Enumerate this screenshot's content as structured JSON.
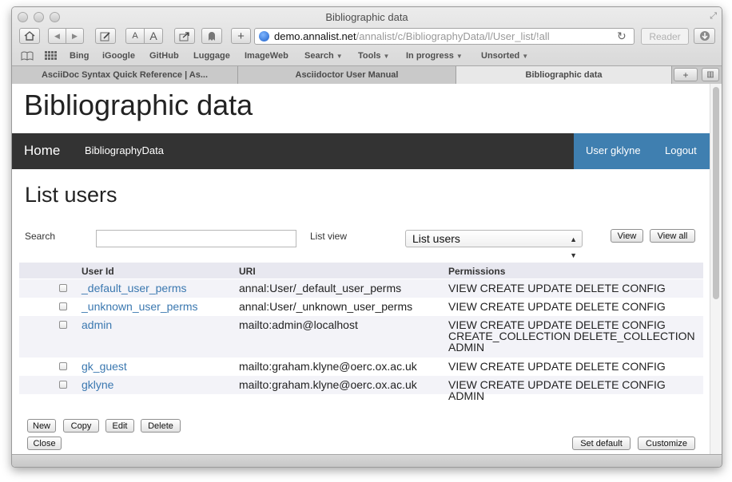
{
  "window": {
    "title": "Bibliographic data"
  },
  "toolbar": {
    "font_small": "A",
    "font_large": "A",
    "new_tab": "+",
    "reader": "Reader"
  },
  "address": {
    "host": "demo.annalist.net",
    "path": "/annalist/c/BibliographyData/l/User_list/!all"
  },
  "bookmarks": [
    {
      "label": "Bing"
    },
    {
      "label": "iGoogle"
    },
    {
      "label": "GitHub"
    },
    {
      "label": "Luggage"
    },
    {
      "label": "ImageWeb"
    },
    {
      "label": "Search",
      "arrow": "▼"
    },
    {
      "label": "Tools",
      "arrow": "▼"
    },
    {
      "label": "In progress",
      "arrow": "▼"
    },
    {
      "label": "Unsorted",
      "arrow": "▼"
    }
  ],
  "tabs": [
    {
      "label": "AsciiDoc Syntax Quick Reference | As..."
    },
    {
      "label": "Asciidoctor User Manual"
    },
    {
      "label": "Bibliographic data"
    }
  ],
  "tabbar": {
    "new_tab": "+",
    "list": "▥"
  },
  "site": {
    "title": "Bibliographic data"
  },
  "nav": {
    "home": "Home",
    "collection": "BibliographyData",
    "user": "User gklyne",
    "logout": "Logout"
  },
  "page": {
    "heading": "List users"
  },
  "controls": {
    "search_label": "Search",
    "search_value": "",
    "listview_label": "List view",
    "listview_selected": "List users",
    "view_button": "View",
    "view_all_button": "View all"
  },
  "table": {
    "headers": [
      "User Id",
      "URI",
      "Permissions"
    ],
    "rows": [
      {
        "id": "_default_user_perms",
        "uri": "annal:User/_default_user_perms",
        "perms": [
          "VIEW CREATE UPDATE DELETE CONFIG"
        ]
      },
      {
        "id": "_unknown_user_perms",
        "uri": "annal:User/_unknown_user_perms",
        "perms": [
          "VIEW CREATE UPDATE DELETE CONFIG"
        ]
      },
      {
        "id": "admin",
        "uri": "mailto:admin@localhost",
        "perms": [
          "VIEW CREATE UPDATE DELETE CONFIG",
          "CREATE_COLLECTION DELETE_COLLECTION",
          "ADMIN"
        ]
      },
      {
        "id": "gk_guest",
        "uri": "mailto:graham.klyne@oerc.ox.ac.uk",
        "perms": [
          "VIEW CREATE UPDATE DELETE CONFIG"
        ]
      },
      {
        "id": "gklyne",
        "uri": "mailto:graham.klyne@oerc.ox.ac.uk",
        "perms": [
          "VIEW CREATE UPDATE DELETE CONFIG ADMIN"
        ]
      }
    ]
  },
  "actions": {
    "new": "New",
    "copy": "Copy",
    "edit": "Edit",
    "delete": "Delete",
    "close": "Close",
    "set_default": "Set default",
    "customize": "Customize"
  }
}
